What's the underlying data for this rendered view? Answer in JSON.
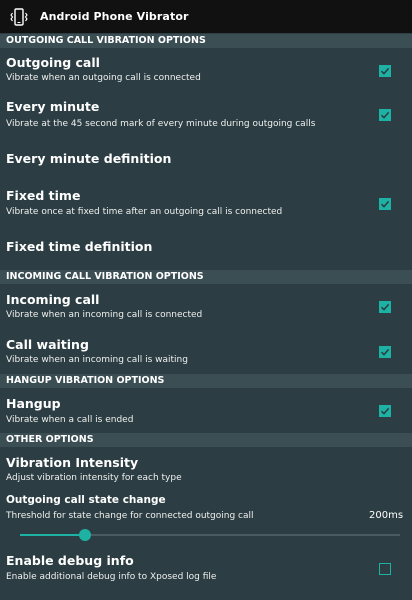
{
  "app": {
    "title": "Android Phone Vibrator",
    "icon": "phone-vibrate-icon"
  },
  "colors": {
    "accent": "#1eb2a5",
    "background": "#2c3e43",
    "section_header": "#3b4e54",
    "titlebar": "#111111"
  },
  "sections": {
    "outgoing": "OUTGOING CALL VIBRATION OPTIONS",
    "incoming": "INCOMING CALL VIBRATION OPTIONS",
    "hangup": "HANGUP VIBRATION OPTIONS",
    "other": "OTHER OPTIONS"
  },
  "items": {
    "outgoing_call": {
      "title": "Outgoing call",
      "summary": "Vibrate when an outgoing call is connected",
      "checked": true
    },
    "every_minute": {
      "title": "Every minute",
      "summary": "Vibrate at the 45 second mark of every minute during outgoing calls",
      "checked": true
    },
    "every_minute_definition": {
      "title": "Every minute definition"
    },
    "fixed_time": {
      "title": "Fixed time",
      "summary": "Vibrate once at fixed time after an outgoing call is connected",
      "checked": true
    },
    "fixed_time_definition": {
      "title": "Fixed time definition"
    },
    "incoming_call": {
      "title": "Incoming call",
      "summary": "Vibrate when an incoming call is connected",
      "checked": true
    },
    "call_waiting": {
      "title": "Call waiting",
      "summary": "Vibrate when an incoming call is waiting",
      "checked": true
    },
    "hangup": {
      "title": "Hangup",
      "summary": "Vibrate when a call is ended",
      "checked": true
    },
    "vibration_intensity": {
      "title": "Vibration Intensity",
      "summary": "Adjust vibration intensity for each type"
    },
    "state_change": {
      "title": "Outgoing call state change",
      "summary": "Threshold for state change for connected outgoing call",
      "value_label": "200ms",
      "slider_fraction": 0.17
    },
    "debug": {
      "title": "Enable debug info",
      "summary": "Enable additional debug info to Xposed log file",
      "checked": false
    }
  }
}
